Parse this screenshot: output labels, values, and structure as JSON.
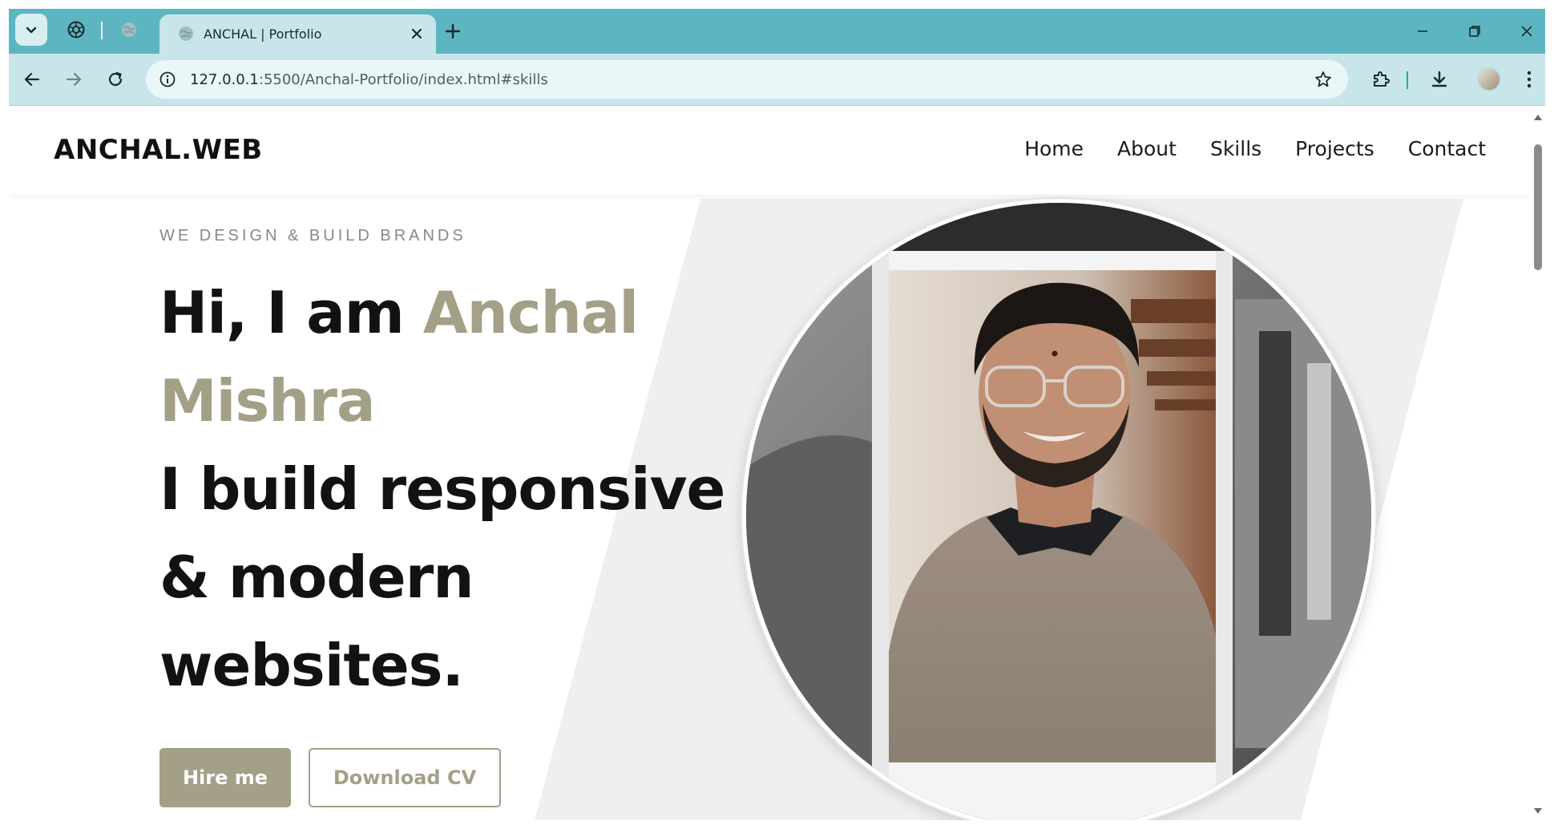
{
  "browser": {
    "tab_title": "ANCHAL | Portfolio",
    "url_host": "127.0.0.1",
    "url_rest": ":5500/Anchal-Portfolio/index.html#skills"
  },
  "icons": {
    "tab_search": "chevron-down-icon",
    "pinned_1": "openai-logo-icon",
    "pinned_2": "globe-icon",
    "tab_favicon": "globe-icon",
    "close": "close-icon",
    "new_tab": "plus-icon",
    "back": "back-arrow-icon",
    "forward": "forward-arrow-icon",
    "reload": "reload-icon",
    "site_info": "info-icon",
    "bookmark": "star-icon",
    "extensions": "puzzle-icon",
    "downloads": "download-icon",
    "menu": "kebab-menu-icon"
  },
  "site": {
    "logo": "ANCHAL.WEB",
    "nav": [
      "Home",
      "About",
      "Skills",
      "Projects",
      "Contact"
    ]
  },
  "hero": {
    "tagline": "WE DESIGN & BUILD BRANDS",
    "intro": "Hi, I am",
    "name_first": "Anchal",
    "name_last": "Mishra",
    "line1": "I build responsive",
    "line2": "& modern",
    "line3": "websites.",
    "primary_button": "Hire me",
    "secondary_button": "Download CV"
  },
  "colors": {
    "accent": "#a3a087",
    "tab_strip": "#5db5c1",
    "toolbar": "#c8e6ea",
    "heading": "#121212",
    "hero_band": "#efefef"
  }
}
